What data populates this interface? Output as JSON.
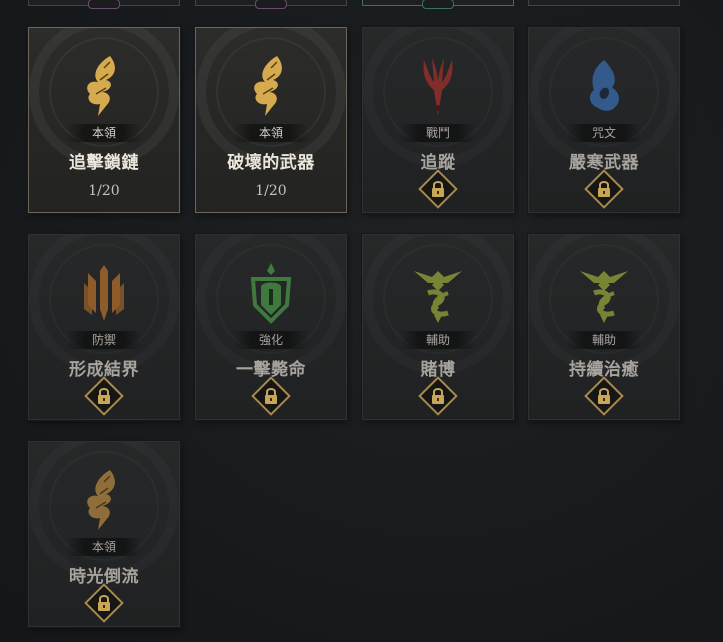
{
  "top_strip": {
    "cards": [
      {
        "accent": "#6a4a6e"
      },
      {
        "accent": "#6a4a6e"
      },
      {
        "accent": "#3e7060"
      },
      {
        "accent": "#4a4448"
      }
    ]
  },
  "cards": [
    {
      "category": "本領",
      "name": "追擊鎖鏈",
      "rank": "1/20",
      "locked": false,
      "icon": "wing-icon",
      "icon_color": "#d6aa4e"
    },
    {
      "category": "本領",
      "name": "破壞的武器",
      "rank": "1/20",
      "locked": false,
      "icon": "wing-icon",
      "icon_color": "#d6aa4e"
    },
    {
      "category": "戰鬥",
      "name": "追蹤",
      "locked": true,
      "icon": "claw-icon",
      "icon_color": "#a8302c"
    },
    {
      "category": "咒文",
      "name": "嚴寒武器",
      "locked": true,
      "icon": "frost-icon",
      "icon_color": "#3b6eb4"
    },
    {
      "category": "防禦",
      "name": "形成結界",
      "locked": true,
      "icon": "shield-blades-icon",
      "icon_color": "#b8702c"
    },
    {
      "category": "強化",
      "name": "一擊斃命",
      "locked": true,
      "icon": "helm-icon",
      "icon_color": "#4a9a48"
    },
    {
      "category": "輔助",
      "name": "賭博",
      "locked": true,
      "icon": "support-sigil-icon",
      "icon_color": "#9aa83a"
    },
    {
      "category": "輔助",
      "name": "持續治癒",
      "locked": true,
      "icon": "support-sigil-icon",
      "icon_color": "#9aa83a"
    },
    {
      "category": "本領",
      "name": "時光倒流",
      "locked": true,
      "icon": "wing-icon",
      "icon_color": "#b88a40"
    }
  ]
}
